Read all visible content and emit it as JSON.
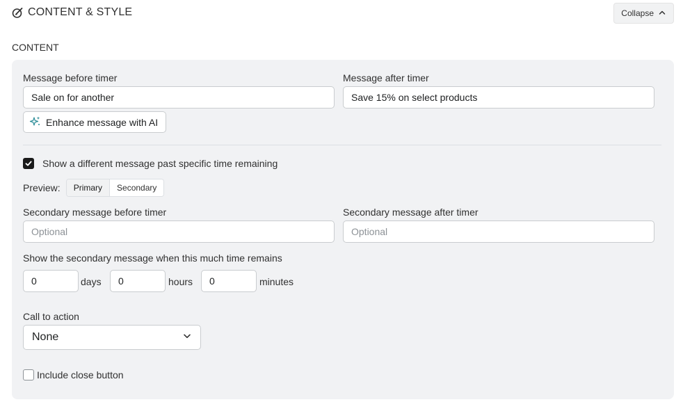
{
  "header": {
    "title": "CONTENT & STYLE",
    "title_icon": "paint-brush-icon",
    "collapse_label": "Collapse",
    "collapse_icon": "chevron-up-icon"
  },
  "section": {
    "label": "CONTENT"
  },
  "content": {
    "message_before": {
      "label": "Message before timer",
      "value": "Sale on for another"
    },
    "message_after": {
      "label": "Message after timer",
      "value": "Save 15% on select products"
    },
    "ai_button": {
      "label": "Enhance message with AI",
      "icon": "sparkle-icon"
    },
    "different_message": {
      "label": "Show a different message past specific time remaining",
      "checked": true
    },
    "preview": {
      "label": "Preview:",
      "options": [
        "Primary",
        "Secondary"
      ],
      "selected": "Primary"
    },
    "secondary_before": {
      "label": "Secondary message before timer",
      "placeholder": "Optional"
    },
    "secondary_after": {
      "label": "Secondary message after timer",
      "placeholder": "Optional"
    },
    "time_remaining": {
      "label": "Show the secondary message when this much time remains",
      "days": {
        "value": "0",
        "unit": "days"
      },
      "hours": {
        "value": "0",
        "unit": "hours"
      },
      "minutes": {
        "value": "0",
        "unit": "minutes"
      }
    },
    "cta": {
      "label": "Call to action",
      "value": "None",
      "icon": "chevron-down-icon"
    },
    "close_button": {
      "label": "Include close button",
      "checked": false
    }
  },
  "colors": {
    "panel_bg": "#f1f2f4",
    "checkbox_checked": "#1a1a1a",
    "ai_icon": "#2a8c97"
  }
}
